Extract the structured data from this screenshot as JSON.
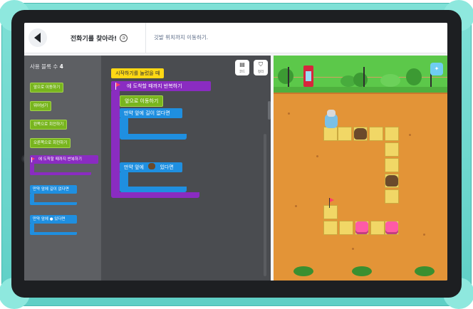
{
  "header": {
    "title": "전화기를 찾아라!",
    "info_icon": "circled-question-icon",
    "goal": "깃발 위치까지 이동하기."
  },
  "palette": {
    "count_label": "사용 블록 수",
    "count_value": "4",
    "blocks": [
      {
        "label": "앞으로 이동하기",
        "color": "#78b51e"
      },
      {
        "label": "뛰어넘기",
        "color": "#78b51e"
      },
      {
        "label": "왼쪽으로 회전하기",
        "color": "#78b51e"
      },
      {
        "label": "오른쪽으로 회전하기",
        "color": "#78b51e"
      },
      {
        "label": "에 도착할 때까지 반복하기",
        "color": "#8a2cc1"
      },
      {
        "label": "만약 앞에 길이 없다면",
        "color": "#1f8fe0"
      },
      {
        "label": "만약 앞에 ● 있다면",
        "color": "#1f8fe0"
      }
    ]
  },
  "toolbar": {
    "code_label": "코드",
    "reset_label": "정리"
  },
  "workspace": {
    "start": "시작하기를 눌렀을 때",
    "repeat": "에 도착할 때까지 반복하기",
    "move": "앞으로 이동하기",
    "if_no_path": "만약 앞에 길이 없다면",
    "if_ahead_a": "만약 앞에",
    "if_ahead_b": "있다면"
  },
  "game": {
    "tip_icon": "wand-icon"
  }
}
